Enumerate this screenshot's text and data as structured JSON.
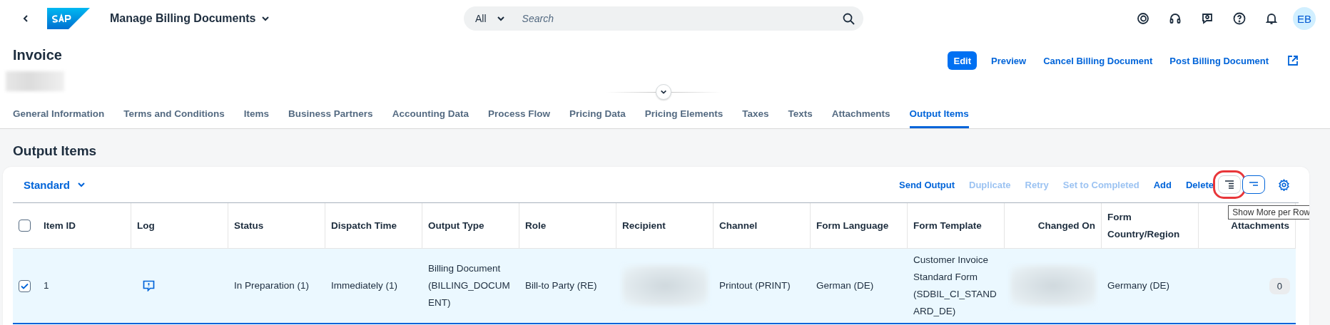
{
  "shell": {
    "title": "Manage Billing Documents",
    "search": {
      "scope": "All",
      "placeholder": "Search"
    },
    "avatar": "EB"
  },
  "header": {
    "title": "Invoice",
    "actions": [
      {
        "label": "Edit",
        "kind": "emphasized"
      },
      {
        "label": "Preview",
        "kind": "link"
      },
      {
        "label": "Cancel Billing Document",
        "kind": "link"
      },
      {
        "label": "Post Billing Document",
        "kind": "link"
      },
      {
        "kind": "share"
      }
    ]
  },
  "tabs": [
    {
      "label": "General Information",
      "selected": false
    },
    {
      "label": "Terms and Conditions",
      "selected": false
    },
    {
      "label": "Items",
      "selected": false
    },
    {
      "label": "Business Partners",
      "selected": false
    },
    {
      "label": "Accounting Data",
      "selected": false
    },
    {
      "label": "Process Flow",
      "selected": false
    },
    {
      "label": "Pricing Data",
      "selected": false
    },
    {
      "label": "Pricing Elements",
      "selected": false
    },
    {
      "label": "Taxes",
      "selected": false
    },
    {
      "label": "Texts",
      "selected": false
    },
    {
      "label": "Attachments",
      "selected": false
    },
    {
      "label": "Output Items",
      "selected": true
    }
  ],
  "section": {
    "title": "Output Items",
    "variant": "Standard",
    "actions": [
      {
        "label": "Send Output",
        "disabled": false
      },
      {
        "label": "Duplicate",
        "disabled": true
      },
      {
        "label": "Retry",
        "disabled": true
      },
      {
        "label": "Set to Completed",
        "disabled": true
      },
      {
        "label": "Add",
        "disabled": false
      },
      {
        "label": "Delete",
        "disabled": false
      }
    ],
    "view_buttons": [
      {
        "kind": "more",
        "selected": false,
        "highlighted": true,
        "tooltip": "Show More per Row"
      },
      {
        "kind": "less",
        "selected": true,
        "highlighted": false
      }
    ],
    "select_all_checked": false,
    "columns": [
      {
        "label": "Item ID",
        "kind": "text"
      },
      {
        "label": "Log",
        "kind": "text"
      },
      {
        "label": "Status",
        "kind": "text"
      },
      {
        "label": "Dispatch Time",
        "kind": "text"
      },
      {
        "label": "Output Type",
        "kind": "text"
      },
      {
        "label": "Role",
        "kind": "text"
      },
      {
        "label": "Recipient",
        "kind": "text"
      },
      {
        "label": "Channel",
        "kind": "text"
      },
      {
        "label": "Form Language",
        "kind": "text"
      },
      {
        "label": "Form Template",
        "kind": "text"
      },
      {
        "label": "Changed On",
        "kind": "numeric"
      },
      {
        "label": "Form Country/Region",
        "kind": "text"
      },
      {
        "label": "Attachments",
        "kind": "numeric"
      }
    ],
    "rows": [
      {
        "selected": true,
        "checked": true,
        "cells": [
          {
            "kind": "text",
            "text": "1"
          },
          {
            "kind": "log"
          },
          {
            "kind": "text",
            "text": "In Preparation (1)"
          },
          {
            "kind": "text",
            "text": "Immediately (1)"
          },
          {
            "kind": "text",
            "text": "Billing Document (BILLING_DOCUMENT)"
          },
          {
            "kind": "text",
            "text": "Bill-to Party (RE)"
          },
          {
            "kind": "blurred"
          },
          {
            "kind": "text",
            "text": "Printout (PRINT)"
          },
          {
            "kind": "text",
            "text": "German (DE)"
          },
          {
            "kind": "text",
            "text": "Customer Invoice Standard Form (SDBIL_CI_STANDARD_DE)"
          },
          {
            "kind": "blurred"
          },
          {
            "kind": "text",
            "text": "Germany (DE)"
          },
          {
            "kind": "count",
            "text": "0"
          }
        ]
      }
    ]
  }
}
